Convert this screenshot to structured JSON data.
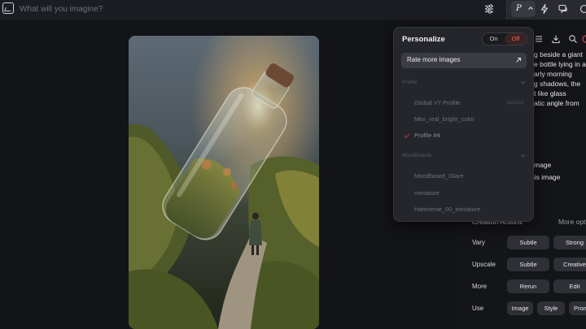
{
  "prompt_bar": {
    "placeholder": "What will you imagine?",
    "personalize_label": "P"
  },
  "popover": {
    "title": "Personalize",
    "toggle_on": "On",
    "toggle_off": "Off",
    "rate_button": "Rate more images",
    "profile_group": "Profile",
    "profiles": [
      {
        "label": "Global V7 Profile",
        "tag": "Default"
      },
      {
        "label": "Mini_real_bright_color"
      },
      {
        "label": "Profile #4",
        "selected": true
      }
    ],
    "moodboard_group": "Moodboards",
    "moodboards": [
      "Moodboard_Glare",
      "miniature",
      "Haniverse_00_miniature"
    ]
  },
  "sidebar": {
    "prompt_lines": [
      "g beside a giant",
      "e bottle lying in a",
      "arly morning",
      "g shadows, the",
      "t like glass",
      "atic angle from"
    ],
    "partial_lines": [
      "mage",
      "his image"
    ],
    "creation_actions": "Creation Actions",
    "more_options": "More opti",
    "rows": [
      {
        "label": "Vary",
        "buttons": [
          "Subtle",
          "Strong"
        ]
      },
      {
        "label": "Upscale",
        "buttons": [
          "Subtle",
          "Creative"
        ]
      },
      {
        "label": "More",
        "buttons": [
          "Rerun",
          "Edit"
        ]
      },
      {
        "label": "Use",
        "buttons": [
          "Image",
          "Style",
          "Prom"
        ]
      }
    ]
  },
  "colors": {
    "background": "#131418",
    "accent_off": "#ff5a4e",
    "chip": "#2f3036"
  }
}
